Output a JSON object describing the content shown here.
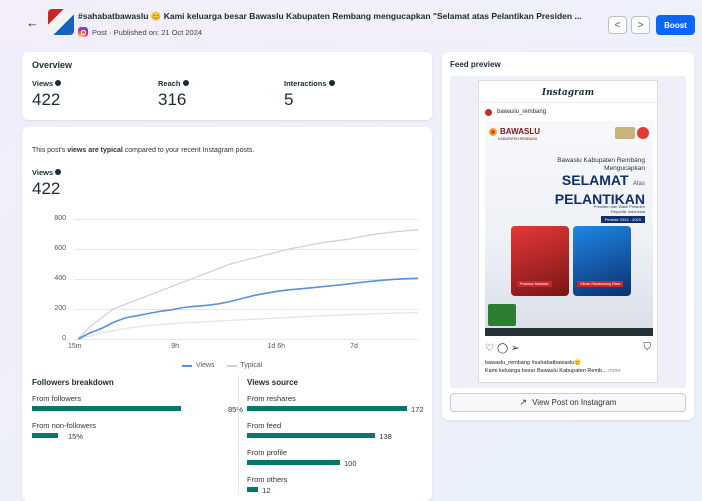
{
  "header": {
    "title": "#sahabatbawaslu 😊 Kami keluarga besar Bawaslu Kabupaten Rembang mengucapkan \"Selamat atas Pelantikan Presiden ...",
    "subtitle": "Post · Published on: 21 Oct 2024",
    "boost_label": "Boost",
    "prev": "<",
    "next": ">",
    "back": "←"
  },
  "overview": {
    "title": "Overview",
    "metrics": [
      {
        "label": "Views",
        "value": "422"
      },
      {
        "label": "Reach",
        "value": "316"
      },
      {
        "label": "Interactions",
        "value": "5"
      }
    ]
  },
  "views_card": {
    "typical_prefix": "This post's ",
    "typical_bold": "views are typical",
    "typical_suffix": " compared to your recent Instagram posts.",
    "views_label": "Views",
    "views_value": "422",
    "legend_views": "Views",
    "legend_typical": "Typical"
  },
  "chart_data": {
    "type": "line",
    "x_ticks": [
      "15m",
      "9h",
      "1d 6h",
      "7d"
    ],
    "y_ticks": [
      "800",
      "600",
      "400",
      "200",
      "0"
    ],
    "ylim": [
      0,
      800
    ],
    "series": [
      {
        "name": "Views",
        "color": "#5b8fd9",
        "values": [
          0,
          40,
          70,
          110,
          140,
          155,
          170,
          185,
          195,
          210,
          218,
          225,
          235,
          250,
          270,
          290,
          305,
          318,
          328,
          335,
          342,
          350,
          358,
          366,
          376,
          385,
          392,
          398,
          402,
          405
        ]
      },
      {
        "name": "Typical",
        "color": "#d0d4da",
        "values": [
          0,
          80,
          140,
          200,
          230,
          260,
          290,
          320,
          350,
          380,
          410,
          440,
          470,
          500,
          520,
          540,
          560,
          580,
          600,
          615,
          630,
          645,
          655,
          665,
          680,
          695,
          705,
          715,
          722,
          728
        ]
      },
      {
        "name": "Typical-low",
        "color": "#e2e5e9",
        "values": [
          0,
          20,
          40,
          55,
          70,
          80,
          90,
          96,
          102,
          108,
          112,
          116,
          120,
          124,
          128,
          132,
          136,
          140,
          144,
          148,
          152,
          155,
          158,
          161,
          164,
          167,
          170,
          172,
          174,
          176
        ]
      }
    ]
  },
  "followers": {
    "title": "Followers breakdown",
    "items": [
      {
        "label": "From followers",
        "pct": "85%",
        "value": 85
      },
      {
        "label": "From non-followers",
        "pct": "15%",
        "value": 15
      }
    ]
  },
  "sources": {
    "title": "Views source",
    "items": [
      {
        "label": "From reshares",
        "value": 172
      },
      {
        "label": "From feed",
        "value": 138
      },
      {
        "label": "From profile",
        "value": 100
      },
      {
        "label": "From others",
        "value": 12
      }
    ]
  },
  "preview": {
    "title": "Feed preview",
    "brand": "Instagram",
    "account": "bawaslu_rembang",
    "org": "BAWASLU",
    "org_sub": "KABUPATEN REMBANG",
    "line1": "Bawaslu Kabupaten Rembang",
    "line2": "Mengucapkan",
    "selamat": "SELAMAT",
    "atas": "Atas",
    "pelantikan": "PELANTIKAN",
    "pres1": "Presiden dan Wakil Presiden",
    "pres2": "Republik Indonesia",
    "periode": "Periode 2024 - 2029",
    "name1": "Prabowo Subianto",
    "name2": "Gibran Rakabuming Raka",
    "caption1": "bawaslu_rembang #sahabatbawaslu😊",
    "caption2": "Kami keluarga besar Bawaslu Kabupaten Remb...",
    "more": "more",
    "view_button": "View Post on Instagram"
  }
}
